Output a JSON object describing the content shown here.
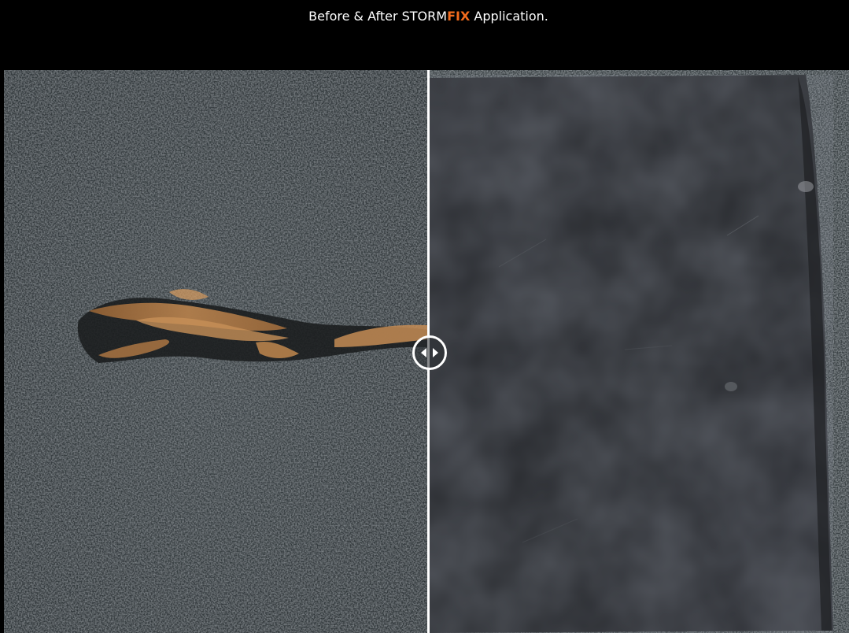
{
  "header": {
    "title_prefix": "Before & After STORM",
    "title_brand_highlight": "FIX",
    "title_suffix": " Application."
  },
  "colors": {
    "background": "#000000",
    "title_text": "#ffffff",
    "brand_highlight": "#f26b1d",
    "divider": "#ffffff",
    "shingle_granules": "#3d4548",
    "repair_coating": "#2a2c31",
    "exposed_fiber": "#b07a45"
  },
  "comparison": {
    "before_image": "damaged-shingle-photo",
    "after_image": "repaired-shingle-photo",
    "slider_icon": "left-right-arrows-icon"
  }
}
